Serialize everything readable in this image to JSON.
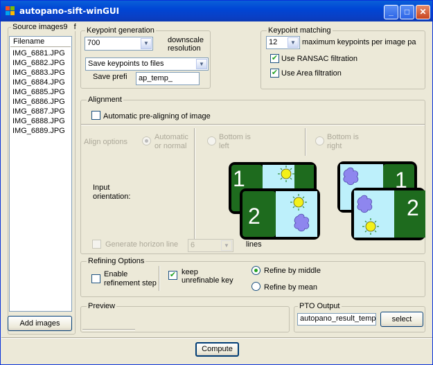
{
  "window": {
    "title": "autopano-sift-winGUI",
    "minimize_glyph": "_",
    "maximize_glyph": "□",
    "close_glyph": "✕"
  },
  "source": {
    "group_title": "Source images9",
    "group_title_suffix": "f",
    "column_header": "Filename",
    "files": [
      "IMG_6881.JPG",
      "IMG_6882.JPG",
      "IMG_6883.JPG",
      "IMG_6884.JPG",
      "IMG_6885.JPG",
      "IMG_6886.JPG",
      "IMG_6887.JPG",
      "IMG_6888.JPG",
      "IMG_6889.JPG"
    ],
    "add_button": "Add images"
  },
  "keypoint_generation": {
    "title": "Keypoint generation",
    "resolution_value": "700",
    "resolution_label_1": "downscale",
    "resolution_label_2": "resolution",
    "save_mode_value": "Save keypoints to files",
    "save_prefix_label": "Save prefi",
    "save_prefix_value": "ap_temp_"
  },
  "keypoint_matching": {
    "title": "Keypoint matching",
    "max_keypoints_value": "12",
    "max_keypoints_label": "maximum keypoints per image pa",
    "ransac_label": "Use RANSAC filtration",
    "ransac_checked": true,
    "area_label": "Use Area filtration",
    "area_checked": true
  },
  "alignment": {
    "title": "Alignment",
    "auto_prealign_label": "Automatic pre-aligning of image",
    "auto_prealign_checked": false,
    "align_options_label": "Align options",
    "option_automatic_1": "Automatic",
    "option_automatic_2": "or normal",
    "option_bottom_left_1": "Bottom is",
    "option_bottom_left_2": "left",
    "option_bottom_right_1": "Bottom is",
    "option_bottom_right_2": "right",
    "input_orientation_1": "Input",
    "input_orientation_2": "orientation:",
    "generate_horizon_label": "Generate  horizon line",
    "horizon_lines_value": "6",
    "horizon_lines_label": "lines",
    "image_numbers": [
      "1",
      "2",
      "1",
      "2"
    ]
  },
  "refining": {
    "title": "Refining Options",
    "enable_label_1": "Enable",
    "enable_label_2": "refinement step",
    "enable_checked": false,
    "keep_label_1": "keep",
    "keep_label_2": "unrefinable key",
    "keep_checked": true,
    "refine_middle_label": "Refine by middle",
    "refine_middle_selected": true,
    "refine_mean_label": "Refine by mean",
    "refine_mean_selected": false
  },
  "preview": {
    "title": "Preview"
  },
  "pto_output": {
    "title": "PTO Output",
    "value": "autopano_result_temp",
    "select_button": "select"
  },
  "compute_button": "Compute",
  "colors": {
    "titlebar": "#0a5fd8",
    "dark_green": "#1e6b1e",
    "sky": "#bdf0fb",
    "sun": "#f3f01a",
    "cloud": "#8e86ee"
  },
  "icons": {
    "app": "windows-logo-icon",
    "check": "checkmark-icon",
    "dropdown": "chevron-down-icon",
    "sun": "sun-icon",
    "cloud": "cloud-icon"
  }
}
